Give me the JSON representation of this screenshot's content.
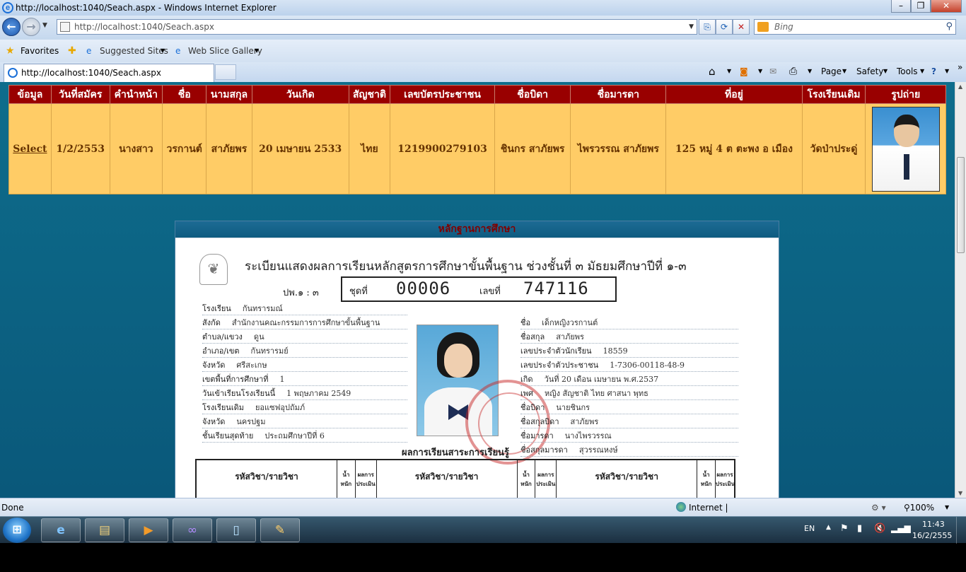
{
  "window": {
    "title": "http://localhost:1040/Seach.aspx - Windows Internet Explorer"
  },
  "nav": {
    "address": "http://localhost:1040/Seach.aspx",
    "search_placeholder": "Bing"
  },
  "favorites": {
    "favorites_label": "Favorites",
    "suggested_label": "Suggested Sites",
    "gallery_label": "Web Slice Gallery"
  },
  "tab": {
    "title": "http://localhost:1040/Seach.aspx"
  },
  "commandbar": {
    "page": "Page",
    "safety": "Safety",
    "tools": "Tools"
  },
  "grid": {
    "headers": [
      "ข้อมูล",
      "วันที่สมัคร",
      "คำนำหน้า",
      "ชื่อ",
      "นามสกุล",
      "วันเกิด",
      "สัญชาติ",
      "เลขบัตรประชาชน",
      "ชื่อบิดา",
      "ชื่อมารดา",
      "ที่อยู่",
      "โรงเรียนเดิม",
      "รูปถ่าย"
    ],
    "row": {
      "select": "Select",
      "apply_date": "1/2/2553",
      "prefix": "นางสาว",
      "first_name": "วรกานต์",
      "last_name": "สาภัยพร",
      "birth_date": "20 เมษายน 2533",
      "nationality": "ไทย",
      "id_card": "1219900279103",
      "father": "ชินกร สาภัยพร",
      "mother": "ไพรวรรณ สาภัยพร",
      "address": "125 หมู่ 4 ต ตะพง อ เมือง",
      "old_school": "วัดป่าประดู่"
    }
  },
  "evidence": {
    "title": "หลักฐานการศึกษา",
    "heading": "ระเบียนแสดงผลการเรียนหลักสูตรการศึกษาขั้นพื้นฐาน ช่วงชั้นที่ ๓ มัธยมศึกษาปีที่ ๑-๓",
    "form_code": "ปพ.๑ : ๓",
    "set_label": "ชุดที่",
    "set_no": "00006",
    "num_label": "เลขที่",
    "num": "747116",
    "left_fields": [
      {
        "label": "โรงเรียน",
        "value": "กันทรารมณ์"
      },
      {
        "label": "สังกัด",
        "value": "สำนักงานคณะกรรมการการศึกษาขั้นพื้นฐาน"
      },
      {
        "label": "ตำบล/แขวง",
        "value": "ดูน"
      },
      {
        "label": "อำเภอ/เขต",
        "value": "กันทรารมย์"
      },
      {
        "label": "จังหวัด",
        "value": "ศรีสะเกษ"
      },
      {
        "label": "เขตพื้นที่การศึกษาที่",
        "value": "1"
      },
      {
        "label": "วันเข้าเรียนโรงเรียนนี้",
        "value": "1 พฤษภาคม 2549"
      },
      {
        "label": "โรงเรียนเดิม",
        "value": "ยอแซฟอุปถัมภ์"
      },
      {
        "label": "จังหวัด",
        "value": "นครปฐม"
      },
      {
        "label": "ชั้นเรียนสุดท้าย",
        "value": "ประถมศึกษาปีที่ 6"
      }
    ],
    "right_fields": [
      {
        "label": "ชื่อ",
        "value": "เด็กหญิงวรกานต์"
      },
      {
        "label": "ชื่อสกุล",
        "value": "สาภัยพร"
      },
      {
        "label": "เลขประจำตัวนักเรียน",
        "value": "18559"
      },
      {
        "label": "เลขประจำตัวประชาชน",
        "value": "1-7306-00118-48-9"
      },
      {
        "label": "เกิด",
        "value": "วันที่ 20 เดือน เมษายน พ.ศ.2537"
      },
      {
        "label": "เพศ",
        "value": "หญิง  สัญชาติ  ไทย  ศาสนา  พุทธ"
      },
      {
        "label": "ชื่อบิดา",
        "value": "นายชินกร"
      },
      {
        "label": "ชื่อสกุลบิดา",
        "value": "สาภัยพร"
      },
      {
        "label": "ชื่อมารดา",
        "value": "นางไพรวรรณ"
      },
      {
        "label": "ชื่อสกุลมารดา",
        "value": "สุวรรณหงษ์"
      }
    ],
    "results_heading": "ผลการเรียนสาระการเรียนรู้",
    "subject_header": "รหัสวิชา/รายวิชา",
    "credit_header": "น้ำหนัก",
    "grade_header": "ผลการประเมิน"
  },
  "status": {
    "text": "Done",
    "zone": "Internet | Protected Mode: Off",
    "zoom": "100%"
  },
  "tray": {
    "lang": "EN",
    "time": "11:43",
    "date": "16/2/2555"
  }
}
